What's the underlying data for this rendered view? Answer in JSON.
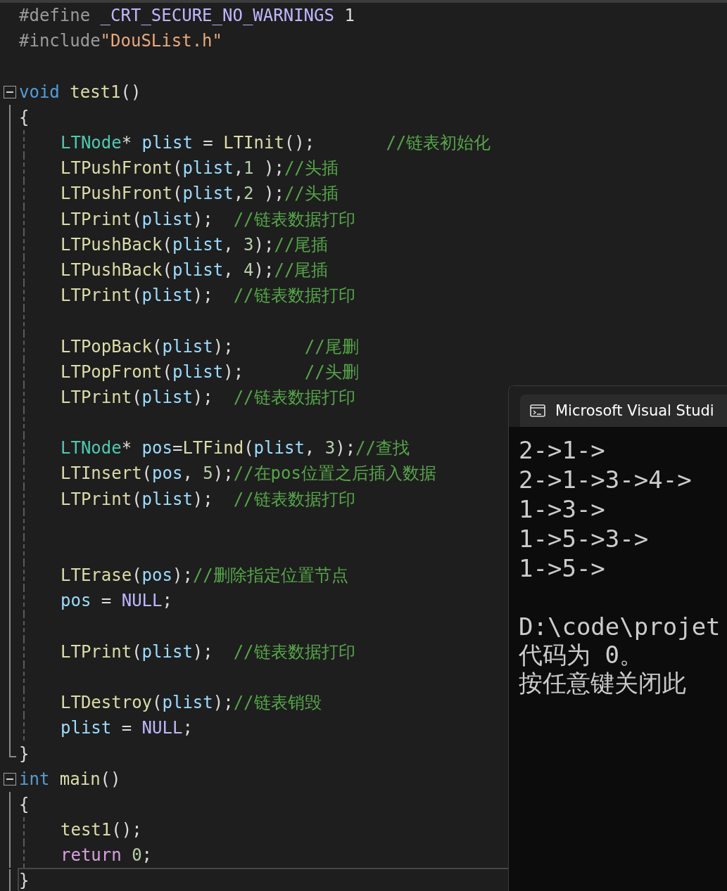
{
  "editor": {
    "lines": [
      {
        "tokens": [
          {
            "kind": "preproc",
            "text": "#define "
          },
          {
            "kind": "macro",
            "text": "_CRT_SECURE_NO_WARNINGS"
          },
          {
            "kind": "plain",
            "text": " 1"
          }
        ]
      },
      {
        "tokens": [
          {
            "kind": "preproc",
            "text": "#include"
          },
          {
            "kind": "string",
            "text": "\"DouSList.h\""
          }
        ]
      },
      {
        "gap_before": true,
        "collapsible": true,
        "tokens": [
          {
            "kind": "keyword",
            "text": "void "
          },
          {
            "kind": "function",
            "text": "test1"
          },
          {
            "kind": "plain",
            "text": "()"
          }
        ]
      },
      {
        "in_block": true,
        "tokens": [
          {
            "kind": "plain",
            "text": "{"
          }
        ]
      },
      {
        "in_block": true,
        "guide": true,
        "tokens": [
          {
            "kind": "type",
            "text": "LTNode"
          },
          {
            "kind": "plain",
            "text": "* "
          },
          {
            "kind": "variable",
            "text": "plist"
          },
          {
            "kind": "plain",
            "text": " = "
          },
          {
            "kind": "function",
            "text": "LTInit"
          },
          {
            "kind": "plain",
            "text": "();       "
          },
          {
            "kind": "comment",
            "text": "//链表初始化"
          }
        ]
      },
      {
        "in_block": true,
        "guide": true,
        "tokens": [
          {
            "kind": "function",
            "text": "LTPushFront"
          },
          {
            "kind": "plain",
            "text": "("
          },
          {
            "kind": "variable",
            "text": "plist"
          },
          {
            "kind": "plain",
            "text": ","
          },
          {
            "kind": "number",
            "text": "1"
          },
          {
            "kind": "plain",
            "text": " );"
          },
          {
            "kind": "comment",
            "text": "//头插"
          }
        ]
      },
      {
        "in_block": true,
        "guide": true,
        "tokens": [
          {
            "kind": "function",
            "text": "LTPushFront"
          },
          {
            "kind": "plain",
            "text": "("
          },
          {
            "kind": "variable",
            "text": "plist"
          },
          {
            "kind": "plain",
            "text": ","
          },
          {
            "kind": "number",
            "text": "2"
          },
          {
            "kind": "plain",
            "text": " );"
          },
          {
            "kind": "comment",
            "text": "//头插"
          }
        ]
      },
      {
        "in_block": true,
        "guide": true,
        "tokens": [
          {
            "kind": "function",
            "text": "LTPrint"
          },
          {
            "kind": "plain",
            "text": "("
          },
          {
            "kind": "variable",
            "text": "plist"
          },
          {
            "kind": "plain",
            "text": ");  "
          },
          {
            "kind": "comment",
            "text": "//链表数据打印"
          }
        ]
      },
      {
        "in_block": true,
        "guide": true,
        "tokens": [
          {
            "kind": "function",
            "text": "LTPushBack"
          },
          {
            "kind": "plain",
            "text": "("
          },
          {
            "kind": "variable",
            "text": "plist"
          },
          {
            "kind": "plain",
            "text": ", "
          },
          {
            "kind": "number",
            "text": "3"
          },
          {
            "kind": "plain",
            "text": ");"
          },
          {
            "kind": "comment",
            "text": "//尾插"
          }
        ]
      },
      {
        "in_block": true,
        "guide": true,
        "tokens": [
          {
            "kind": "function",
            "text": "LTPushBack"
          },
          {
            "kind": "plain",
            "text": "("
          },
          {
            "kind": "variable",
            "text": "plist"
          },
          {
            "kind": "plain",
            "text": ", "
          },
          {
            "kind": "number",
            "text": "4"
          },
          {
            "kind": "plain",
            "text": ");"
          },
          {
            "kind": "comment",
            "text": "//尾插"
          }
        ]
      },
      {
        "in_block": true,
        "guide": true,
        "tokens": [
          {
            "kind": "function",
            "text": "LTPrint"
          },
          {
            "kind": "plain",
            "text": "("
          },
          {
            "kind": "variable",
            "text": "plist"
          },
          {
            "kind": "plain",
            "text": ");  "
          },
          {
            "kind": "comment",
            "text": "//链表数据打印"
          }
        ]
      },
      {
        "in_block": true,
        "guide": true
      },
      {
        "in_block": true,
        "guide": true,
        "tokens": [
          {
            "kind": "function",
            "text": "LTPopBack"
          },
          {
            "kind": "plain",
            "text": "("
          },
          {
            "kind": "variable",
            "text": "plist"
          },
          {
            "kind": "plain",
            "text": ");       "
          },
          {
            "kind": "comment",
            "text": "//尾删"
          }
        ]
      },
      {
        "in_block": true,
        "guide": true,
        "tokens": [
          {
            "kind": "function",
            "text": "LTPopFront"
          },
          {
            "kind": "plain",
            "text": "("
          },
          {
            "kind": "variable",
            "text": "plist"
          },
          {
            "kind": "plain",
            "text": ");      "
          },
          {
            "kind": "comment",
            "text": "//头删"
          }
        ]
      },
      {
        "in_block": true,
        "guide": true,
        "tokens": [
          {
            "kind": "function",
            "text": "LTPrint"
          },
          {
            "kind": "plain",
            "text": "("
          },
          {
            "kind": "variable",
            "text": "plist"
          },
          {
            "kind": "plain",
            "text": ");  "
          },
          {
            "kind": "comment",
            "text": "//链表数据打印"
          }
        ]
      },
      {
        "in_block": true,
        "guide": true
      },
      {
        "in_block": true,
        "guide": true,
        "tokens": [
          {
            "kind": "type",
            "text": "LTNode"
          },
          {
            "kind": "plain",
            "text": "* "
          },
          {
            "kind": "variable",
            "text": "pos"
          },
          {
            "kind": "plain",
            "text": "="
          },
          {
            "kind": "function",
            "text": "LTFind"
          },
          {
            "kind": "plain",
            "text": "("
          },
          {
            "kind": "variable",
            "text": "plist"
          },
          {
            "kind": "plain",
            "text": ", "
          },
          {
            "kind": "number",
            "text": "3"
          },
          {
            "kind": "plain",
            "text": ");"
          },
          {
            "kind": "comment",
            "text": "//查找"
          }
        ]
      },
      {
        "in_block": true,
        "guide": true,
        "tokens": [
          {
            "kind": "function",
            "text": "LTInsert"
          },
          {
            "kind": "plain",
            "text": "("
          },
          {
            "kind": "variable",
            "text": "pos"
          },
          {
            "kind": "plain",
            "text": ", "
          },
          {
            "kind": "number",
            "text": "5"
          },
          {
            "kind": "plain",
            "text": ");"
          },
          {
            "kind": "comment",
            "text": "//在pos位置之后插入数据"
          }
        ]
      },
      {
        "in_block": true,
        "guide": true,
        "tokens": [
          {
            "kind": "function",
            "text": "LTPrint"
          },
          {
            "kind": "plain",
            "text": "("
          },
          {
            "kind": "variable",
            "text": "plist"
          },
          {
            "kind": "plain",
            "text": ");  "
          },
          {
            "kind": "comment",
            "text": "//链表数据打印"
          }
        ]
      },
      {
        "in_block": true,
        "guide": true
      },
      {
        "in_block": true,
        "guide": true
      },
      {
        "in_block": true,
        "guide": true,
        "tokens": [
          {
            "kind": "function",
            "text": "LTErase"
          },
          {
            "kind": "plain",
            "text": "("
          },
          {
            "kind": "variable",
            "text": "pos"
          },
          {
            "kind": "plain",
            "text": ");"
          },
          {
            "kind": "comment",
            "text": "//删除指定位置节点"
          }
        ]
      },
      {
        "in_block": true,
        "guide": true,
        "tokens": [
          {
            "kind": "variable",
            "text": "pos"
          },
          {
            "kind": "plain",
            "text": " = "
          },
          {
            "kind": "macro",
            "text": "NULL"
          },
          {
            "kind": "plain",
            "text": ";"
          }
        ]
      },
      {
        "in_block": true,
        "guide": true
      },
      {
        "in_block": true,
        "guide": true,
        "tokens": [
          {
            "kind": "function",
            "text": "LTPrint"
          },
          {
            "kind": "plain",
            "text": "("
          },
          {
            "kind": "variable",
            "text": "plist"
          },
          {
            "kind": "plain",
            "text": ");  "
          },
          {
            "kind": "comment",
            "text": "//链表数据打印"
          }
        ]
      },
      {
        "in_block": true,
        "guide": true
      },
      {
        "in_block": true,
        "guide": true,
        "tokens": [
          {
            "kind": "function",
            "text": "LTDestroy"
          },
          {
            "kind": "plain",
            "text": "("
          },
          {
            "kind": "variable",
            "text": "plist"
          },
          {
            "kind": "plain",
            "text": ");"
          },
          {
            "kind": "comment",
            "text": "//链表销毁"
          }
        ]
      },
      {
        "in_block": true,
        "guide": true,
        "tokens": [
          {
            "kind": "variable",
            "text": "plist"
          },
          {
            "kind": "plain",
            "text": " = "
          },
          {
            "kind": "macro",
            "text": "NULL"
          },
          {
            "kind": "plain",
            "text": ";"
          }
        ]
      },
      {
        "block_end": true,
        "tokens": [
          {
            "kind": "plain",
            "text": "}"
          }
        ]
      },
      {
        "collapsible": true,
        "tokens": [
          {
            "kind": "keyword",
            "text": "int "
          },
          {
            "kind": "function",
            "text": "main"
          },
          {
            "kind": "plain",
            "text": "()"
          }
        ]
      },
      {
        "in_block": true,
        "tokens": [
          {
            "kind": "plain",
            "text": "{"
          }
        ]
      },
      {
        "in_block": true,
        "guide": true,
        "tokens": [
          {
            "kind": "function",
            "text": "test1"
          },
          {
            "kind": "plain",
            "text": "();"
          }
        ]
      },
      {
        "in_block": true,
        "guide": true,
        "tokens": [
          {
            "kind": "control",
            "text": "return "
          },
          {
            "kind": "number",
            "text": "0"
          },
          {
            "kind": "plain",
            "text": ";"
          }
        ]
      },
      {
        "in_block": true,
        "current": true,
        "tokens": [
          {
            "kind": "plain",
            "text": "}"
          }
        ]
      }
    ]
  },
  "console": {
    "title": "Microsoft Visual Studi",
    "output": [
      "2->1->",
      "2->1->3->4->",
      "1->3->",
      "1->5->3->",
      "1->5->"
    ],
    "exit_message": [
      "D:\\code\\projet",
      "代码为 0。",
      "按任意键关闭此"
    ]
  }
}
